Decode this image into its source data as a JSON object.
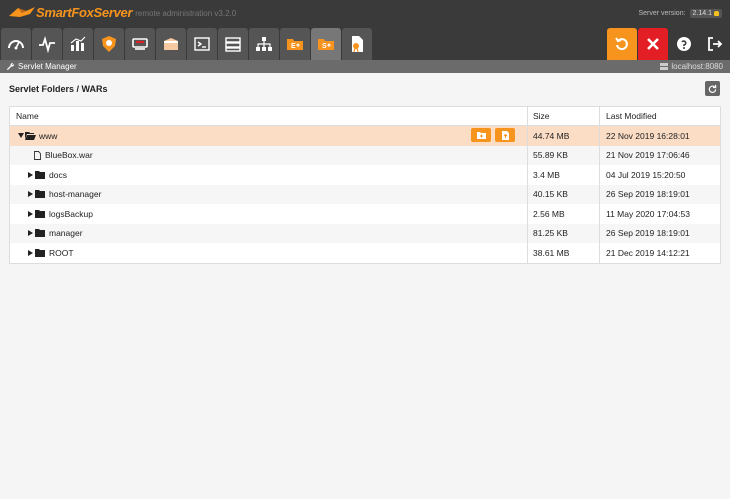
{
  "app": {
    "logo_text": "SmartFoxServer",
    "logo_sub": "remote administration v3.2.0",
    "version_label": "Server version:",
    "version_value": "2.14.1"
  },
  "tabs": [
    {
      "icon": "dashboard-icon"
    },
    {
      "icon": "monitor-pulse-icon"
    },
    {
      "icon": "analytics-icon"
    },
    {
      "icon": "virus-shield-icon"
    },
    {
      "icon": "bannedusers-icon"
    },
    {
      "icon": "zone-box-icon"
    },
    {
      "icon": "console-icon"
    },
    {
      "icon": "server-icon"
    },
    {
      "icon": "hierarchy-icon"
    },
    {
      "icon": "extension-deploy-icon",
      "text": "E"
    },
    {
      "icon": "servlet-deploy-icon",
      "text": "S",
      "active": true
    },
    {
      "icon": "license-icon"
    }
  ],
  "actions": [
    {
      "icon": "restart-icon",
      "color": "#f7941d"
    },
    {
      "icon": "halt-icon",
      "color": "#e31e24"
    },
    {
      "icon": "help-icon"
    },
    {
      "icon": "logout-icon"
    }
  ],
  "subbar": {
    "module_title": "Servlet Manager",
    "host": "localhost:8080"
  },
  "section_title": "Servlet Folders / WARs",
  "table": {
    "headers": {
      "name": "Name",
      "size": "Size",
      "modified": "Last Modified"
    },
    "rows": [
      {
        "name": "www",
        "size": "44.74 MB",
        "modified": "22 Nov 2019 16:28:01",
        "type": "folder-open",
        "expanded": true,
        "selected": true,
        "indent": 0
      },
      {
        "name": "BlueBox.war",
        "size": "55.89 KB",
        "modified": "21 Nov 2019 17:06:46",
        "type": "file",
        "indent": 1
      },
      {
        "name": "docs",
        "size": "3.4 MB",
        "modified": "04 Jul 2019 15:20:50",
        "type": "folder",
        "indent": 1
      },
      {
        "name": "host-manager",
        "size": "40.15 KB",
        "modified": "26 Sep 2019 18:19:01",
        "type": "folder",
        "indent": 1
      },
      {
        "name": "logsBackup",
        "size": "2.56 MB",
        "modified": "11 May 2020 17:04:53",
        "type": "folder",
        "indent": 1
      },
      {
        "name": "manager",
        "size": "81.25 KB",
        "modified": "26 Sep 2019 18:19:01",
        "type": "folder",
        "indent": 1
      },
      {
        "name": "ROOT",
        "size": "38.61 MB",
        "modified": "21 Dec 2019 14:12:21",
        "type": "folder",
        "indent": 1
      }
    ]
  },
  "colors": {
    "accent": "#f7941d",
    "danger": "#e31e24",
    "selected_row": "#fbdcc4"
  }
}
